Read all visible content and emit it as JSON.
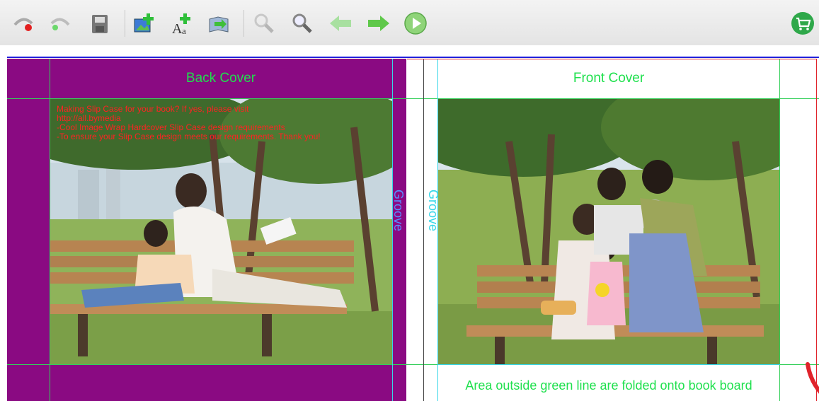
{
  "toolbar": {
    "buttons": [
      {
        "name": "undo-button",
        "icon": "undo-icon"
      },
      {
        "name": "redo-button",
        "icon": "redo-icon"
      },
      {
        "name": "save-button",
        "icon": "save-icon"
      },
      {
        "name": "add-image-button",
        "icon": "add-image-icon"
      },
      {
        "name": "add-text-button",
        "icon": "add-text-icon"
      },
      {
        "name": "import-button",
        "icon": "import-icon"
      },
      {
        "name": "zoom-out-button",
        "icon": "zoom-out-icon"
      },
      {
        "name": "zoom-in-button",
        "icon": "zoom-in-icon"
      },
      {
        "name": "previous-button",
        "icon": "arrow-left-icon"
      },
      {
        "name": "next-button",
        "icon": "arrow-right-icon"
      },
      {
        "name": "play-button",
        "icon": "play-icon"
      },
      {
        "name": "cart-button",
        "icon": "cart-icon"
      }
    ]
  },
  "canvas": {
    "back_cover_title": "Back Cover",
    "front_cover_title": "Front Cover",
    "groove_left": "Groove",
    "groove_right": "Groove",
    "instruction_lines": [
      "Making Slip Case for your book? If yes, please visit",
      "http://all.bymedia",
      "-Cool Image Wrap Hardcover Slip Case design requirements",
      "-To ensure your Slip Case design meets our requirements. Thank you!"
    ],
    "fold_note": "Area outside green line are folded onto book board"
  },
  "colors": {
    "spine_purple": "#8a0a82",
    "guide_green": "#34d05a",
    "guide_cyan": "#36d7e8",
    "guide_red": "#e0232b",
    "title_green": "#1fe04d",
    "note_red": "#ff2222"
  }
}
